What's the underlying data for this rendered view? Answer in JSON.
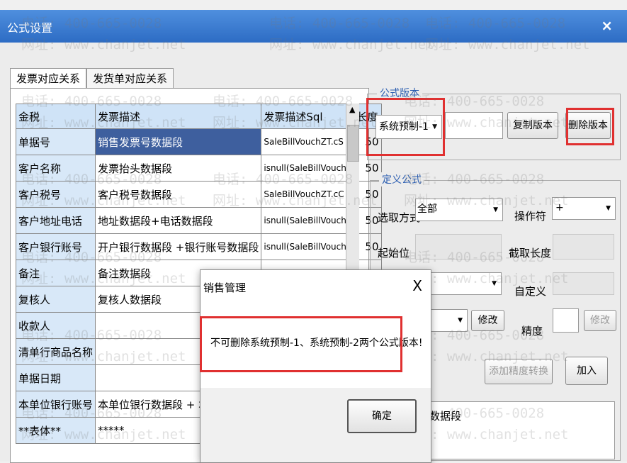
{
  "window": {
    "title": "公式设置",
    "close_glyph": "×"
  },
  "tabs": [
    "发票对应关系",
    "发货单对应关系"
  ],
  "grid": {
    "columns": [
      "金税",
      "发票描述",
      "发票描述Sql",
      "长度"
    ],
    "rows": [
      {
        "key": "单据号",
        "desc": "销售发票号数据段",
        "sql": "SaleBillVouchZT.cS",
        "len": "50"
      },
      {
        "key": "客户名称",
        "desc": "发票抬头数据段",
        "sql": "isnull(SaleBillVouch2",
        "len": "50"
      },
      {
        "key": "客户税号",
        "desc": "客户税号数据段",
        "sql": "SaleBillVouchZT.cC",
        "len": "50"
      },
      {
        "key": "客户地址电话",
        "desc": "地址数据段+电话数据段",
        "sql": "isnull(SaleBillVouch2",
        "len": "50"
      },
      {
        "key": "客户银行账号",
        "desc": "开户银行数据段 +银行账号数据段",
        "sql": "isnull(SaleBillVouch2",
        "len": "50"
      },
      {
        "key": "备注",
        "desc": "备注数据段",
        "sql": "",
        "len": ""
      },
      {
        "key": "复核人",
        "desc": "复核人数据段",
        "sql": "",
        "len": ""
      },
      {
        "key": "收款人",
        "desc": "",
        "sql": "",
        "len": ""
      },
      {
        "key": "清单行商品名称",
        "desc": "",
        "sql": "",
        "len": ""
      },
      {
        "key": "单据日期",
        "desc": "",
        "sql": "",
        "len": ""
      },
      {
        "key": "本单位银行账号",
        "desc": "本单位银行数据段 + 本单位",
        "sql": "",
        "len": ""
      },
      {
        "key": "**表体**",
        "desc": "*****",
        "sql": "",
        "len": ""
      }
    ],
    "scroll_up_glyph": "▲"
  },
  "formula_version": {
    "legend": "公式版本",
    "selected": "系统预制-1",
    "name_value": "",
    "copy_button": "复制版本",
    "delete_button": "删除版本"
  },
  "define_formula": {
    "legend": "定义公式",
    "select_mode_label": "选取方式",
    "select_mode_value": "全部",
    "operator_label": "操作符",
    "operator_value": "+",
    "start_label": "起始位",
    "length_label": "截取长度",
    "custom_label": "自定义",
    "modify_button": "修改",
    "precision_label": "精度",
    "modify_button_2": "修改",
    "add_precision_button": "添加精度转换",
    "add_button": "加入",
    "formula_text": "数据段"
  },
  "dialog": {
    "title": "销售管理",
    "close_glyph": "X",
    "message": "不可删除系统预制-1、系统预制-2两个公式版本!",
    "ok_button": "确定"
  },
  "watermark": {
    "phone": "电话: 400-665-0028",
    "site": "网址: www.chanjet.net"
  },
  "colors": {
    "highlight_red": "#e03030",
    "selected_row": "#3e5f9e",
    "titlebar": "#2d6cc4"
  }
}
